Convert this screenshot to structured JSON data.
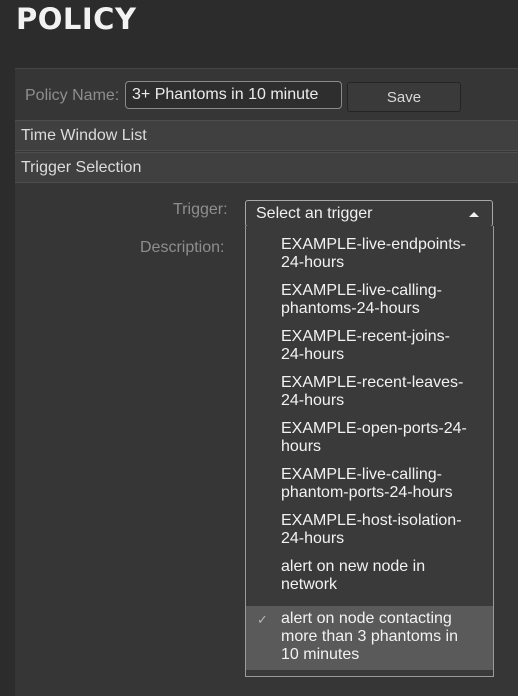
{
  "page": {
    "title": "POLICY"
  },
  "policy_form": {
    "name_label": "Policy Name:",
    "name_value": "3+ Phantoms in 10 minute",
    "save_label": "Save"
  },
  "sections": {
    "time_window_list": "Time Window List",
    "trigger_selection": "Trigger Selection"
  },
  "trigger": {
    "label": "Trigger:",
    "selected_text": "Select an trigger",
    "description_label": "Description:",
    "options": [
      {
        "label": "EXAMPLE-live-endpoints-24-hours",
        "line1": "EXAMPLE-live-endpoints-",
        "line2": "24-hours"
      },
      {
        "label": "EXAMPLE-live-calling-phantoms-24-hours",
        "line1": "EXAMPLE-live-calling-",
        "line2": "phantoms-24-hours"
      },
      {
        "label": "EXAMPLE-recent-joins-24-hours",
        "line1": "EXAMPLE-recent-joins-",
        "line2": "24-hours"
      },
      {
        "label": "EXAMPLE-recent-leaves-24-hours",
        "line1": "EXAMPLE-recent-leaves-",
        "line2": "24-hours"
      },
      {
        "label": "EXAMPLE-open-ports-24-hours",
        "line1": "EXAMPLE-open-ports-24-",
        "line2": "hours"
      },
      {
        "label": "EXAMPLE-live-calling-phantom-ports-24-hours",
        "line1": "EXAMPLE-live-calling-",
        "line2": "phantom-ports-24-hours"
      },
      {
        "label": "EXAMPLE-host-isolation-24-hours",
        "line1": "EXAMPLE-host-isolation-",
        "line2": "24-hours"
      },
      {
        "label": "alert on new node in network",
        "line1": "alert on new node in",
        "line2": "network"
      },
      {
        "label": "alert on node contacting more than 3 phantoms in 10 minutes",
        "line1": "alert on node contacting",
        "line2": "more than 3 phantoms in",
        "line3": "10 minutes",
        "checked": true,
        "check_glyph": "✓"
      }
    ]
  }
}
